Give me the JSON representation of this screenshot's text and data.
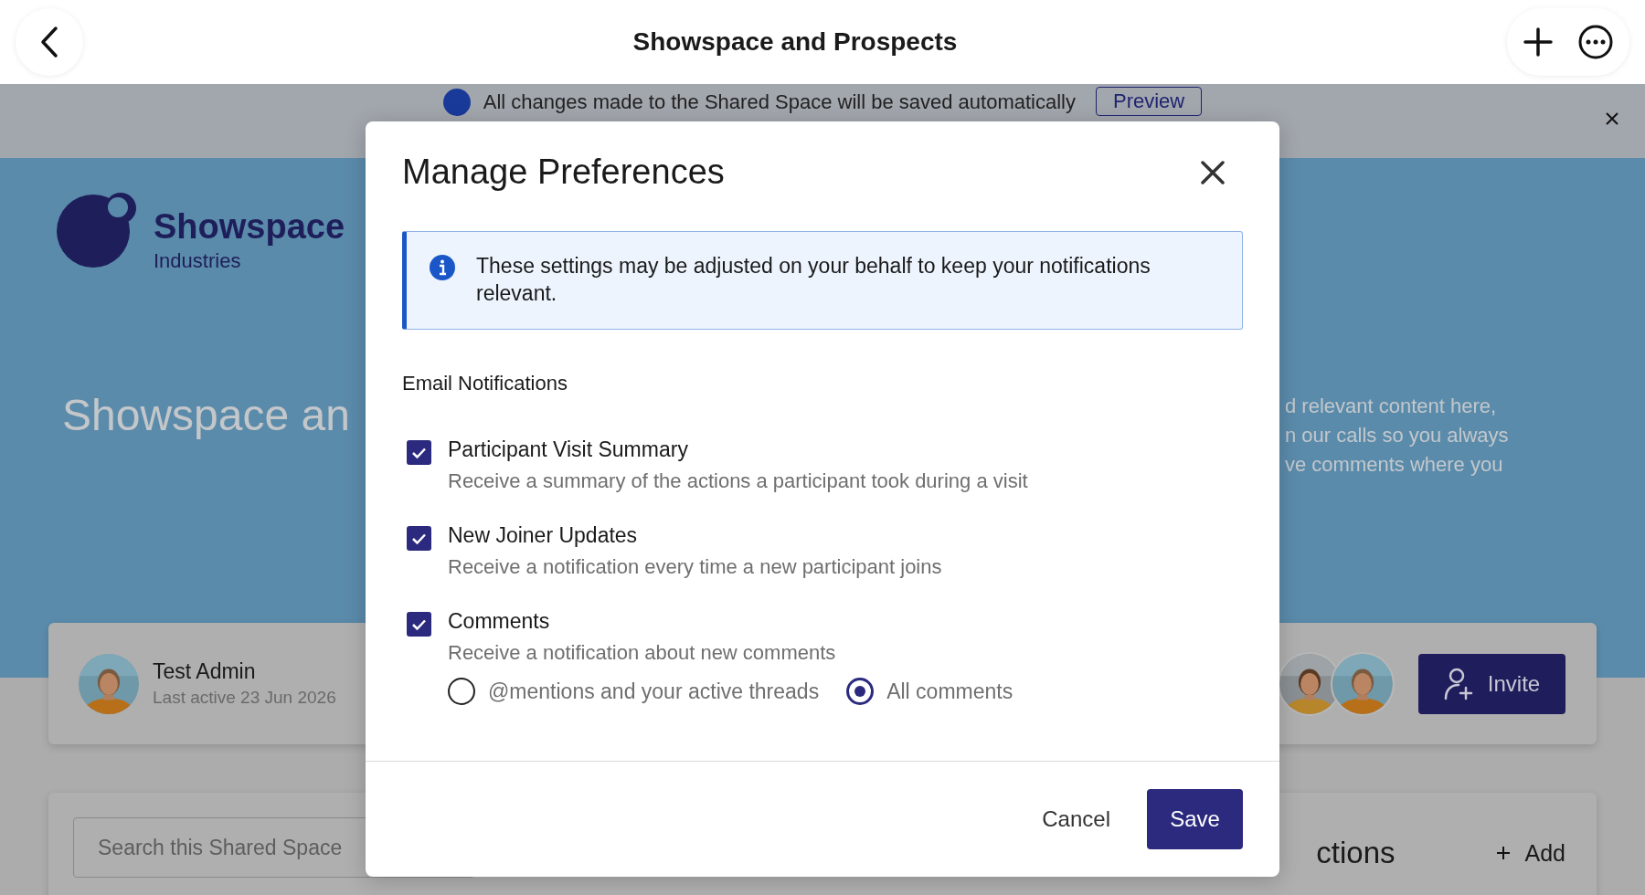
{
  "top_bar": {
    "title": "Showspace and Prospects"
  },
  "banner": {
    "message": "All changes made to the Shared Space will be saved automatically",
    "preview_button": "Preview"
  },
  "brand": {
    "name": "Showspace",
    "tagline": "Industries"
  },
  "hero": {
    "title": "Showspace an",
    "text_lines": [
      "d relevant content here,",
      "n our calls so you always",
      "ve comments where you"
    ]
  },
  "owner_card": {
    "name": "Test Admin",
    "last_active": "Last active 23 Jun 2026",
    "invite_button": "Invite"
  },
  "search": {
    "placeholder": "Search this Shared Space"
  },
  "actions_panel": {
    "title": "ctions",
    "add_button": "Add"
  },
  "dialog": {
    "title": "Manage Preferences",
    "info": "These settings may be adjusted on your behalf to keep your notifications relevant.",
    "section": "Email Notifications",
    "options": [
      {
        "label": "Participant Visit Summary",
        "description": "Receive a summary of the actions a participant took during a visit",
        "checked": true
      },
      {
        "label": "New Joiner Updates",
        "description": "Receive a notification every time a new participant joins",
        "checked": true
      },
      {
        "label": "Comments",
        "description": "Receive a notification about new comments",
        "checked": true
      }
    ],
    "comment_scope": [
      {
        "label": "@mentions and your active threads",
        "selected": false
      },
      {
        "label": "All comments",
        "selected": true
      }
    ],
    "cancel_button": "Cancel",
    "save_button": "Save"
  }
}
